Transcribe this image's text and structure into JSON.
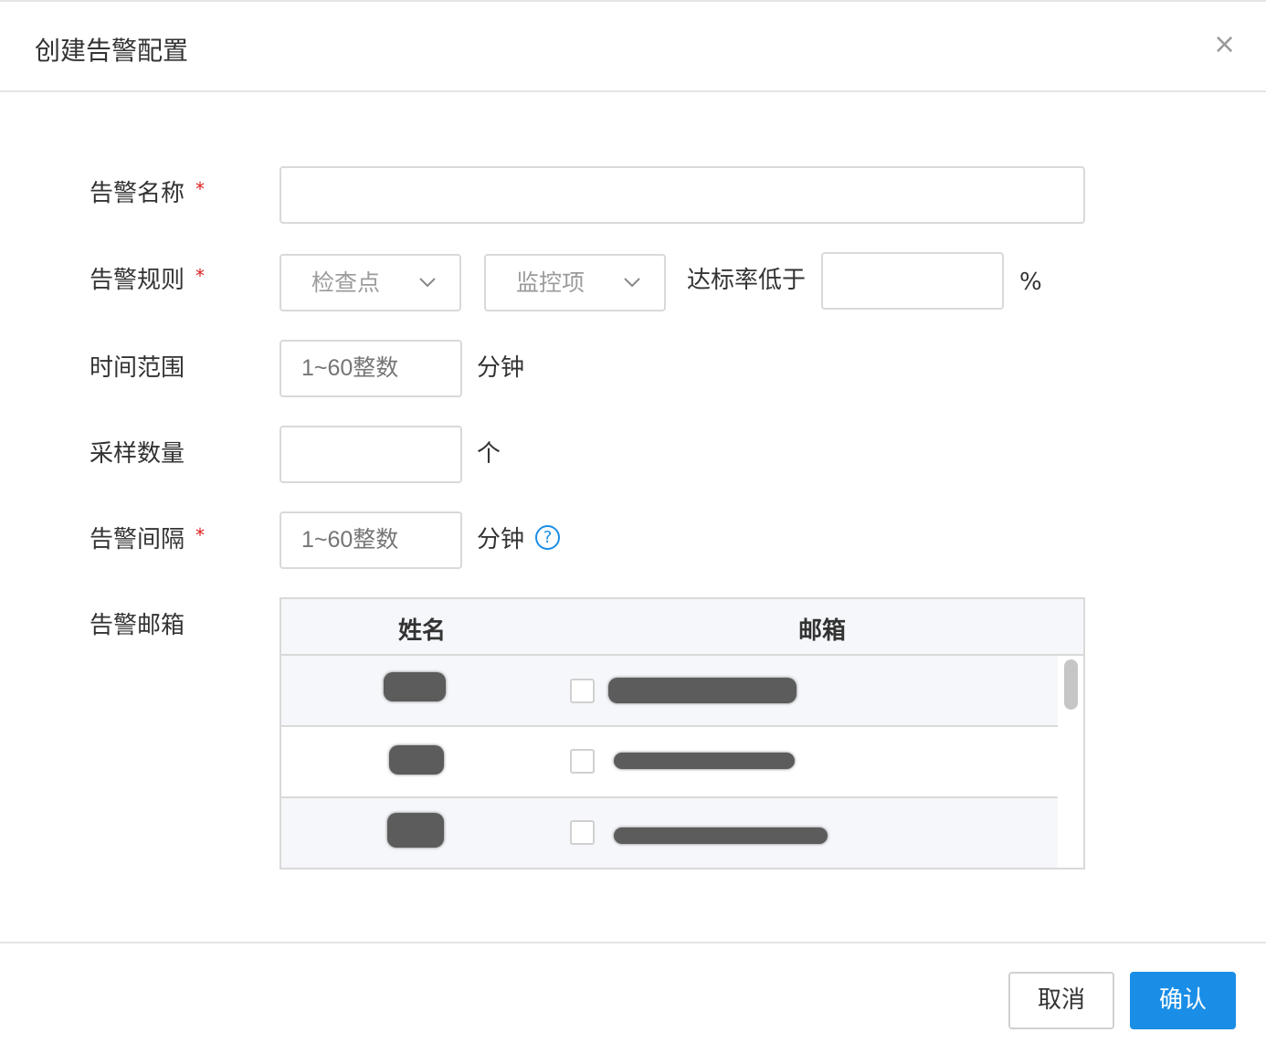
{
  "dialog": {
    "title": "创建告警配置",
    "close_symbol": "×"
  },
  "form": {
    "required_mark": "*",
    "alert_name": {
      "label": "告警名称",
      "value": "",
      "placeholder": ""
    },
    "alert_rule": {
      "label": "告警规则",
      "checkpoint_select": "检查点",
      "monitor_select": "监控项",
      "threshold_text": "达标率低于",
      "threshold_value": "",
      "percent_unit": "%"
    },
    "time_range": {
      "label": "时间范围",
      "placeholder": "1~60整数",
      "unit": "分钟"
    },
    "sample_count": {
      "label": "采样数量",
      "value": "",
      "unit": "个"
    },
    "alert_interval": {
      "label": "告警间隔",
      "placeholder": "1~60整数",
      "unit": "分钟",
      "help_symbol": "?"
    },
    "alert_email": {
      "label": "告警邮箱",
      "columns": [
        "姓名",
        "邮箱"
      ],
      "rows": [
        {
          "name": "[redacted]",
          "email": "[redacted]",
          "checked": false
        },
        {
          "name": "[redacted]",
          "email": "[redacted]",
          "checked": false
        },
        {
          "name": "[redacted]",
          "email": "[redacted]",
          "checked": false
        }
      ]
    }
  },
  "footer": {
    "cancel_label": "取消",
    "confirm_label": "确认"
  },
  "colors": {
    "primary": "#1a8ee6",
    "required": "#e02020",
    "border": "#d9d9d9",
    "table_header_bg": "#f5f7fa"
  }
}
